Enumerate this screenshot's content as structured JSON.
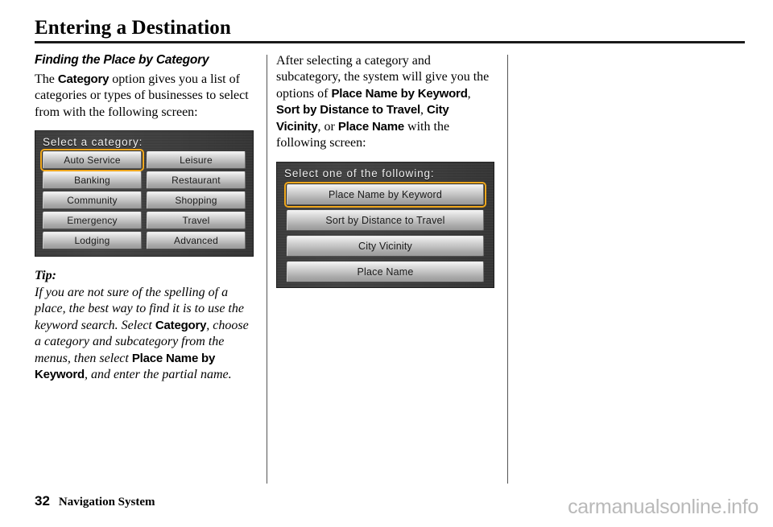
{
  "header": {
    "title": "Entering a Destination"
  },
  "left_column": {
    "section_heading": "Finding the Place by Category",
    "intro": {
      "part1": "The ",
      "term1": "Category",
      "part2": " option gives you a list of categories or types of businesses to select from with the following screen:"
    },
    "tip": {
      "label": "Tip:",
      "part1": "If you are not sure of the spelling of a place, the best way to find it is to use the keyword search. Select ",
      "term1": "Category",
      "part2": ", choose a category and subcategory from the menus, then select ",
      "term2": "Place Name by Keyword",
      "part3": ", and enter the partial name."
    },
    "screen": {
      "title": "Select a category:",
      "left_buttons": [
        {
          "label": "Auto Service",
          "selected": true
        },
        {
          "label": "Banking",
          "selected": false
        },
        {
          "label": "Community",
          "selected": false
        },
        {
          "label": "Emergency",
          "selected": false
        },
        {
          "label": "Lodging",
          "selected": false
        }
      ],
      "right_buttons": [
        {
          "label": "Leisure",
          "selected": false
        },
        {
          "label": "Restaurant",
          "selected": false
        },
        {
          "label": "Shopping",
          "selected": false
        },
        {
          "label": "Travel",
          "selected": false
        },
        {
          "label": "Advanced",
          "selected": false
        }
      ]
    }
  },
  "right_column": {
    "intro": {
      "part1": "After selecting a category and subcategory, the system will give you the options of ",
      "term1": "Place Name by Keyword",
      "part2": ", ",
      "term2": "Sort by Distance to Travel",
      "part3": ", ",
      "term3": "City Vicinity",
      "part4": ", or ",
      "term4": "Place Name",
      "part5": " with the following screen:"
    },
    "screen": {
      "title": "Select one of the following:",
      "buttons": [
        {
          "label": "Place Name by Keyword",
          "selected": true
        },
        {
          "label": "Sort by Distance to Travel",
          "selected": false
        },
        {
          "label": "City Vicinity",
          "selected": false
        },
        {
          "label": "Place Name",
          "selected": false
        }
      ]
    }
  },
  "footer": {
    "page_number": "32",
    "document_title": "Navigation System",
    "watermark": "carmanualsonline.info"
  },
  "colors": {
    "selection_highlight": "#f0a81e",
    "screen_background": "#3d3d3d",
    "button_face": "#c3c3c3",
    "watermark": "#b9b9b9"
  }
}
